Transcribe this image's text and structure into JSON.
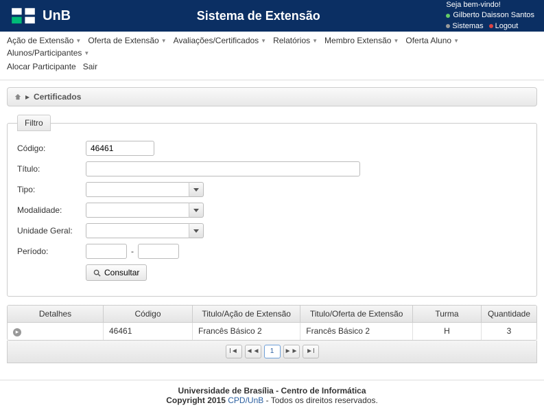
{
  "header": {
    "brand": "UnB",
    "title": "Sistema de Extensão",
    "welcome": "Seja bem-vindo!",
    "user": "Gilberto Daisson Santos",
    "link_sistemas": "Sistemas",
    "link_logout": "Logout"
  },
  "menu": {
    "row1": [
      "Ação de Extensão",
      "Oferta de Extensão",
      "Avaliações/Certificados",
      "Relatórios",
      "Membro Extensão",
      "Oferta Aluno",
      "Alunos/Participantes"
    ],
    "row2": [
      "Alocar Participante",
      "Sair"
    ]
  },
  "breadcrumb": {
    "current": "Certificados"
  },
  "filter": {
    "legend": "Filtro",
    "labels": {
      "codigo": "Código:",
      "titulo": "Título:",
      "tipo": "Tipo:",
      "modalidade": "Modalidade:",
      "unidade": "Unidade Geral:",
      "periodo": "Período:"
    },
    "values": {
      "codigo": "46461",
      "titulo": "",
      "tipo": "",
      "modalidade": "",
      "unidade": "",
      "periodo_ini": "",
      "periodo_fim": ""
    },
    "consultar": "Consultar"
  },
  "table": {
    "headers": {
      "detalhes": "Detalhes",
      "codigo": "Código",
      "titulo_acao": "Titulo/Ação de Extensão",
      "titulo_oferta": "Titulo/Oferta de Extensão",
      "turma": "Turma",
      "quantidade": "Quantidade"
    },
    "rows": [
      {
        "codigo": "46461",
        "titulo_acao": "Francês Básico 2",
        "titulo_oferta": "Francês Básico 2",
        "turma": "H",
        "quantidade": "3"
      }
    ],
    "page": "1"
  },
  "footer": {
    "line1": "Universidade de Brasília - Centro de Informática",
    "copyright_prefix": "Copyright 2015 ",
    "copyright_link": "CPD/UnB",
    "copyright_suffix": " - Todos os direitos reservados."
  }
}
